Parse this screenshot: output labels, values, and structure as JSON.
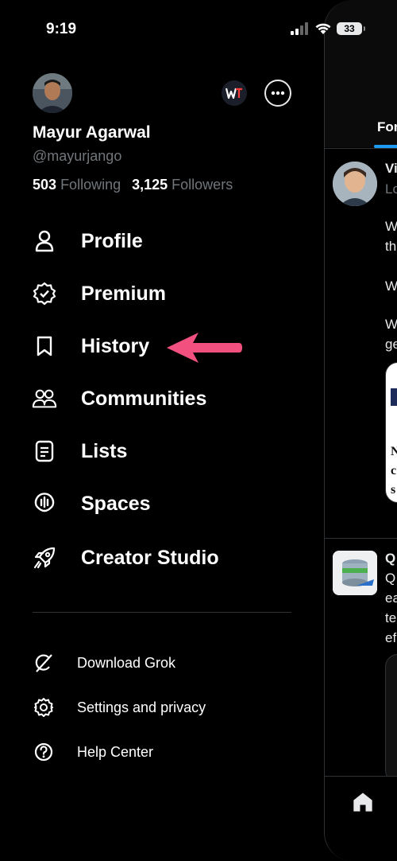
{
  "status_bar": {
    "time": "9:19",
    "battery": "33"
  },
  "profile": {
    "name": "Mayur Agarwal",
    "handle": "@mayurjango",
    "following_count": "503",
    "following_label": "Following",
    "followers_count": "3,125",
    "followers_label": "Followers"
  },
  "menu": [
    {
      "label": "Profile",
      "icon": "person-icon"
    },
    {
      "label": "Premium",
      "icon": "verified-badge-icon"
    },
    {
      "label": "History",
      "icon": "bookmark-icon"
    },
    {
      "label": "Communities",
      "icon": "people-icon"
    },
    {
      "label": "Lists",
      "icon": "list-icon"
    },
    {
      "label": "Spaces",
      "icon": "microphone-icon"
    },
    {
      "label": "Creator Studio",
      "icon": "rocket-icon"
    }
  ],
  "sub_menu": [
    {
      "label": "Download Grok",
      "icon": "grok-icon"
    },
    {
      "label": "Settings and privacy",
      "icon": "gear-icon"
    },
    {
      "label": "Help Center",
      "icon": "help-icon"
    }
  ],
  "timeline_peek": {
    "tab": "For",
    "texts": [
      "Vi",
      "Lo",
      "W",
      "th",
      "W",
      "W",
      "ge",
      "N",
      "c",
      "s",
      "Q",
      "Q",
      "ea",
      "te",
      "ef"
    ]
  },
  "colors": {
    "accent": "#1d9bf0",
    "arrow": "#f2517f",
    "background": "#000000",
    "muted": "#71767b"
  }
}
